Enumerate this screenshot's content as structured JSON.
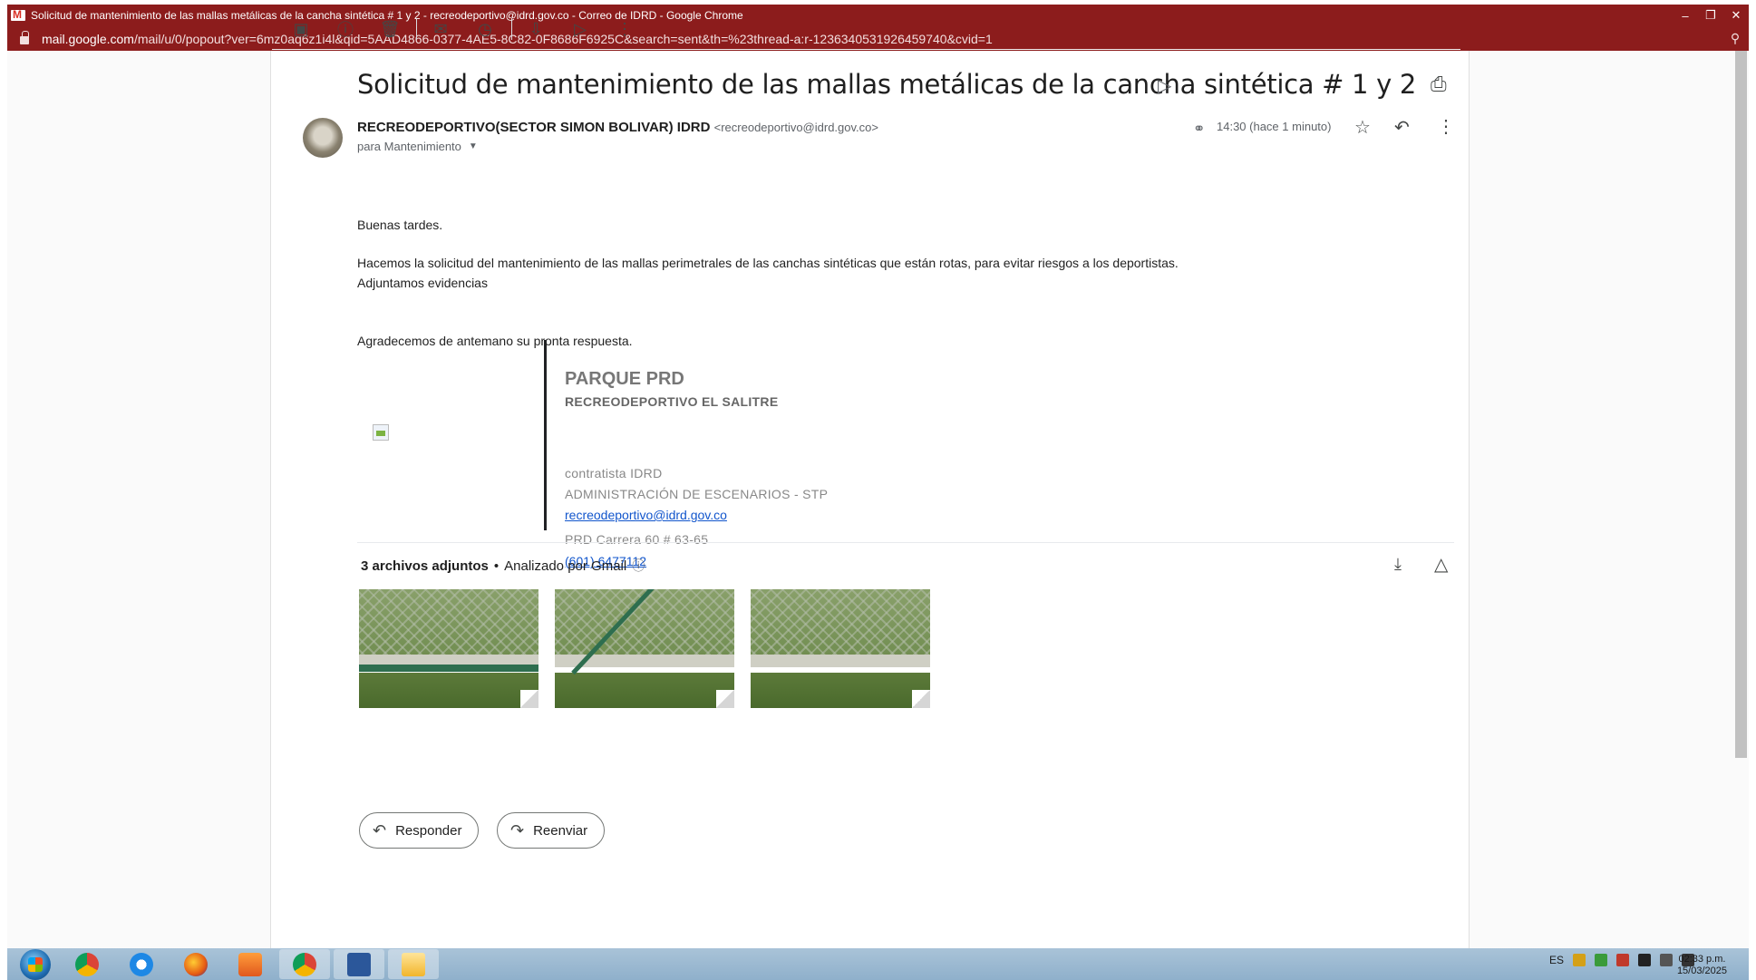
{
  "window": {
    "title": "Solicitud de mantenimiento de las mallas metálicas de la cancha sintética # 1 y 2 - recreodeportivo@idrd.gov.co - Correo de IDRD - Google Chrome",
    "url_host": "mail.google.com",
    "url_rest": "/mail/u/0/popout?ver=6mz0aq6z1i4l&qid=5AAD4866-0377-4AE5-8C82-0F8686F6925C&search=sent&th=%23thread-a:r-1236340531926459740&cvid=1"
  },
  "toolbar": {
    "icons": [
      "archive-icon",
      "spam-icon",
      "delete-icon",
      "mark-unread-icon",
      "snooze-icon",
      "move-to-icon",
      "labels-icon",
      "more-vert-icon"
    ]
  },
  "email": {
    "subject": "Solicitud de mantenimiento de las mallas metálicas de la cancha sintética # 1 y 2",
    "sender_name": "RECREODEPORTIVO(SECTOR SIMON BOLIVAR) IDRD",
    "sender_email": "<recreodeportivo@idrd.gov.co>",
    "recipient": "para Mantenimiento",
    "time": "14:30 (hace 1 minuto)",
    "body": [
      "Buenas tardes.",
      "Hacemos la solicitud del mantenimiento de las mallas perimetrales de las canchas sintéticas que están rotas, para evitar riesgos a los deportistas.",
      "Adjuntamos evidencias",
      "Agradecemos de antemano su pronta respuesta."
    ]
  },
  "signature": {
    "title": "PARQUE PRD",
    "subtitle": "RECREODEPORTIVO EL SALITRE",
    "role": "contratista IDRD",
    "department": "ADMINISTRACIÓN DE ESCENARIOS - STP",
    "email": "recreodeportivo@idrd.gov.co",
    "address": "PRD Carrera 60 # 63-65",
    "phone": "(601) 6477112"
  },
  "attachments": {
    "count_label": "3 archivos adjuntos",
    "scan_label": "Analizado por Gmail"
  },
  "actions": {
    "reply": "Responder",
    "forward": "Reenviar"
  },
  "taskbar": {
    "lang": "ES",
    "time": "02:33 p.m.",
    "date": "15/03/2025"
  }
}
